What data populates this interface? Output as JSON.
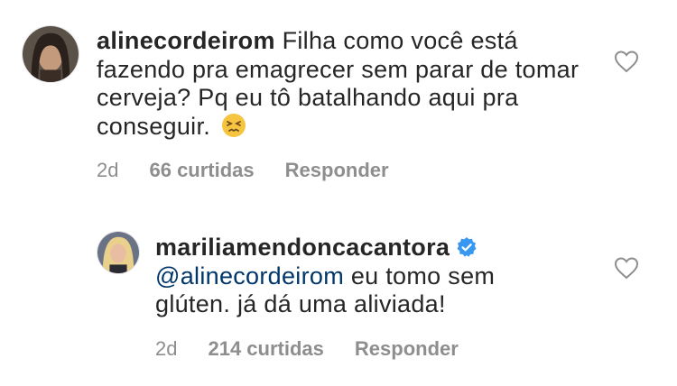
{
  "comments": [
    {
      "username": "alinecordeirom",
      "text": "Filha como você está fazendo pra emagrecer sem parar de tomar cerveja? Pq eu tô batalhando aqui pra conseguir.",
      "emoji": "😣",
      "time": "2d",
      "likes": "66 curtidas",
      "reply": "Responder"
    },
    {
      "username": "mariliamendoncacantora",
      "verified": true,
      "mention": "@alinecordeirom",
      "text": "eu tomo sem glúten. já dá uma aliviada!",
      "time": "2d",
      "likes": "214 curtidas",
      "reply": "Responder"
    }
  ],
  "colors": {
    "text": "#262626",
    "meta": "#8e8e8e",
    "mention": "#00376b",
    "verified": "#3897f0"
  },
  "icons": {
    "like": "heart-outline-icon",
    "verified": "verified-badge-icon"
  }
}
